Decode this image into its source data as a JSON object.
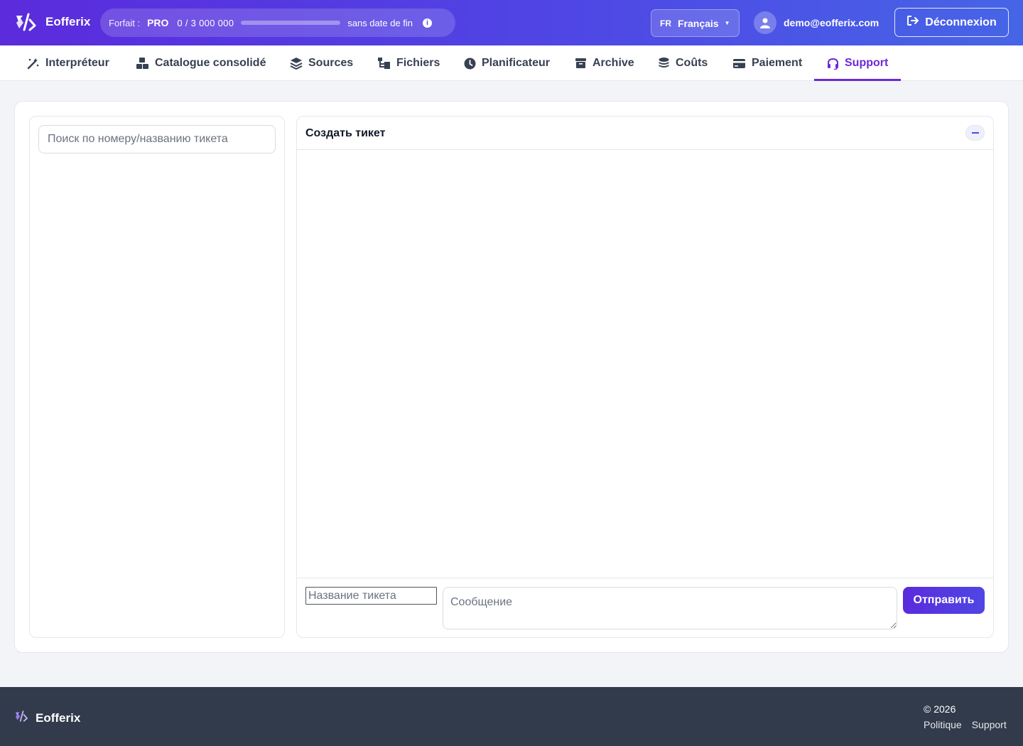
{
  "header": {
    "brand": "Eofferix",
    "plan": {
      "label": "Forfait :",
      "tier": "PRO",
      "usage": "0 / 3 000 000",
      "usage_fraction": 0,
      "validity": "sans date de fin"
    },
    "language": {
      "code": "FR",
      "name": "Français"
    },
    "user_email": "demo@eofferix.com",
    "logout_label": "Déconnexion"
  },
  "nav": {
    "items": [
      {
        "label": "Interpréteur",
        "icon": "magic-wand-icon"
      },
      {
        "label": "Catalogue consolidé",
        "icon": "boxes-icon"
      },
      {
        "label": "Sources",
        "icon": "layers-icon"
      },
      {
        "label": "Fichiers",
        "icon": "folder-tree-icon"
      },
      {
        "label": "Planificateur",
        "icon": "clock-icon"
      },
      {
        "label": "Archive",
        "icon": "archive-box-icon"
      },
      {
        "label": "Coûts",
        "icon": "coins-icon"
      },
      {
        "label": "Paiement",
        "icon": "credit-card-icon"
      },
      {
        "label": "Support",
        "icon": "headset-icon",
        "active": true
      }
    ]
  },
  "tickets": {
    "search_placeholder": "Поиск по номеру/названию тикета"
  },
  "create_ticket": {
    "title": "Создать тикет",
    "name_placeholder": "Название тикета",
    "message_placeholder": "Сообщение",
    "send_label": "Отправить"
  },
  "footer": {
    "brand": "Eofferix",
    "copyright": "© 2026",
    "links": [
      "Politique",
      "Support"
    ]
  },
  "colors": {
    "accent": "#6d28d9",
    "header_gradient_start": "#5b2bdc",
    "header_gradient_end": "#4665e6",
    "footer_bg": "#323b4c"
  }
}
